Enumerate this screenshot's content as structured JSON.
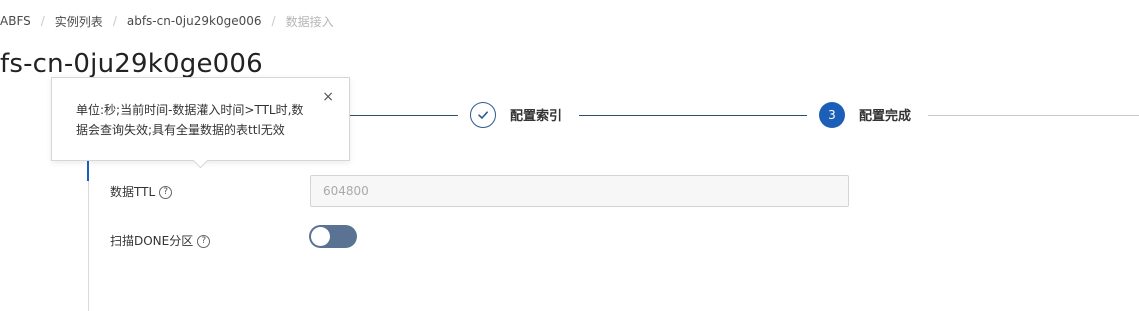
{
  "breadcrumb": {
    "items": [
      "ABFS",
      "实例列表",
      "abfs-cn-0ju29k0ge006",
      "数据接入"
    ],
    "separator": "/"
  },
  "page_title": "fs-cn-0ju29k0ge006",
  "steps": [
    {
      "label": "配置索引",
      "status": "done",
      "icon": "check-icon"
    },
    {
      "label": "配置完成",
      "number": "3",
      "status": "active"
    }
  ],
  "tooltip": {
    "text": "单位:秒;当前时间-数据灌入时间>TTL时,数据会查询失效;具有全量数据的表ttl无效",
    "close_glyph": "×"
  },
  "form": {
    "ttl_label": "数据TTL",
    "ttl_value": "604800",
    "scan_label": "扫描DONE分区",
    "help_glyph": "?",
    "scan_toggle_on": false
  },
  "colors": {
    "accent": "#1c5fb8",
    "toggle_off": "#5a7392",
    "step_line": "#2f4e73"
  }
}
